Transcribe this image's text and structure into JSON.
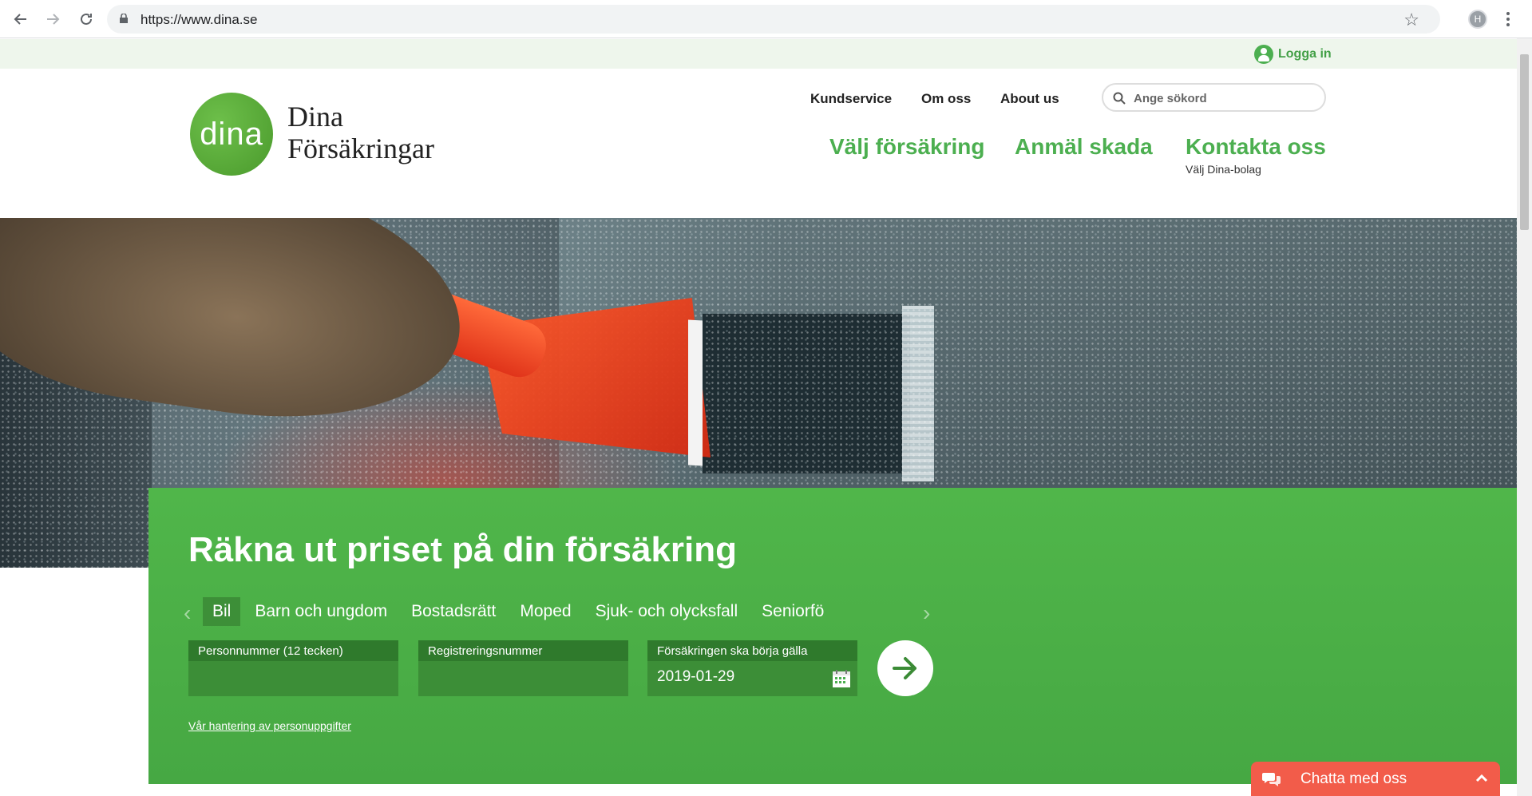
{
  "browser": {
    "url": "https://www.dina.se",
    "profile_initial": "H"
  },
  "topbar": {
    "login_label": "Logga in"
  },
  "header": {
    "logo_mark": "dina",
    "logo_line1": "Dina",
    "logo_line2": "Försäkringar",
    "top_links": [
      "Kundservice",
      "Om oss",
      "About us"
    ],
    "search_placeholder": "Ange sökord",
    "main_nav": [
      "Välj försäkring",
      "Anmäl skada",
      "Kontakta oss"
    ],
    "sub_label": "Välj Dina-bolag"
  },
  "calculator": {
    "title": "Räkna ut priset på din försäkring",
    "tabs": [
      "Bil",
      "Barn och ungdom",
      "Bostadsrätt",
      "Moped",
      "Sjuk- och olycksfall",
      "Seniorfö"
    ],
    "active_tab": "Bil",
    "fields": [
      {
        "label": "Personnummer (12 tecken)",
        "value": ""
      },
      {
        "label": "Registreringsnummer",
        "value": ""
      },
      {
        "label": "Försäkringen ska börja gälla",
        "value": "2019-01-29"
      }
    ],
    "privacy_link": "Vår hantering av personuppgifter"
  },
  "chat": {
    "label": "Chatta med oss"
  },
  "colors": {
    "brand_green": "#4caf50",
    "panel_green": "#4cae47",
    "chat_red": "#f25c4a"
  }
}
